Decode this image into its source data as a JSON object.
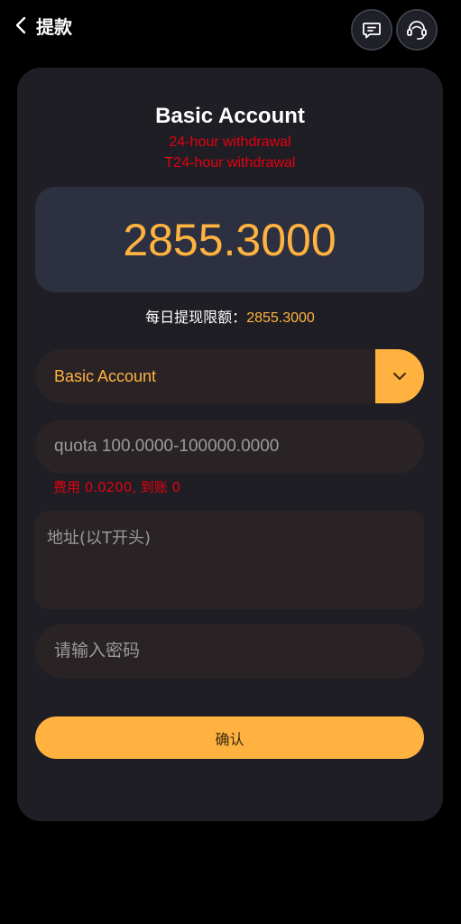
{
  "header": {
    "title": "提款",
    "back_icon": "chevron-left-icon",
    "message_icon": "message-icon",
    "support_icon": "customer-service-icon"
  },
  "account": {
    "name": "Basic Account",
    "line1": "24-hour withdrawal",
    "line2": "T24-hour withdrawal"
  },
  "balance": "2855.3000",
  "daily_limit": {
    "label": "每日提现限额：",
    "value": "2855.3000"
  },
  "account_select": {
    "selected": "Basic Account",
    "arrow_icon": "chevron-down-icon"
  },
  "quota_input": {
    "placeholder": "quota 100.0000-100000.0000",
    "value": ""
  },
  "fee_note": "费用 0.0200, 到账 0",
  "address_input": {
    "placeholder": "地址(以T开头)",
    "value": ""
  },
  "password_input": {
    "placeholder": "请输入密码",
    "value": ""
  },
  "confirm_label": "确认",
  "colors": {
    "accent": "#ffb23f",
    "warning": "#e60012",
    "card": "#1e1e24",
    "balance_box": "#2c3040",
    "field": "#2a2326"
  }
}
